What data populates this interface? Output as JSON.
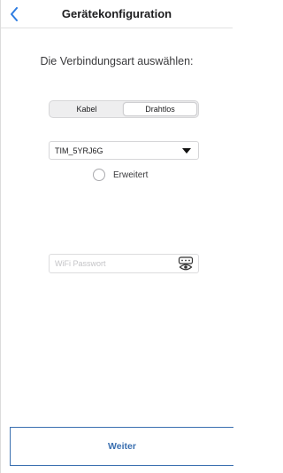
{
  "header": {
    "title": "Gerätekonfiguration",
    "back_icon": "chevron-left-icon"
  },
  "instruction": "Die Verbindungsart auswählen:",
  "connection_type": {
    "options": [
      "Kabel",
      "Drahtlos"
    ],
    "selected": "Drahtlos"
  },
  "network": {
    "selected": "TIM_5YRJ6G"
  },
  "advanced": {
    "label": "Erweitert",
    "checked": false
  },
  "password": {
    "placeholder": "WiFi Passwort",
    "value": "",
    "toggle_icon": "eye-icon"
  },
  "footer": {
    "next_label": "Weiter"
  },
  "colors": {
    "accent": "#3a6fb0",
    "back_arrow": "#2f7de1"
  }
}
